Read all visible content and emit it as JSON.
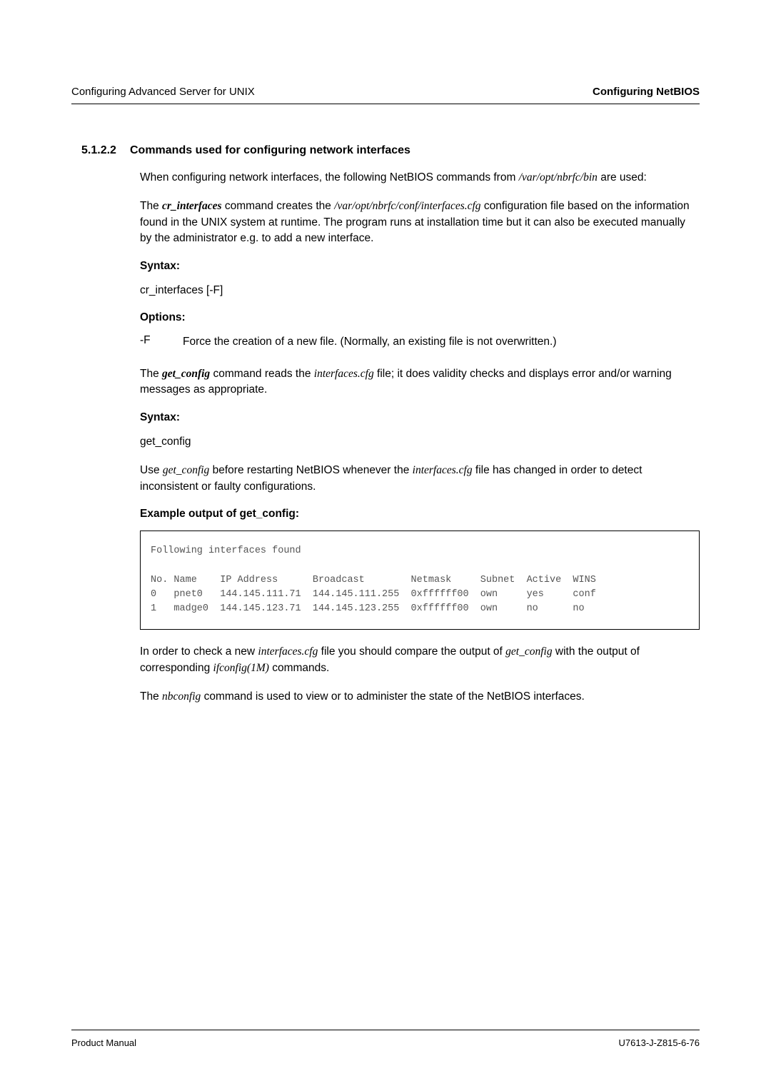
{
  "header": {
    "left": "Configuring Advanced Server for UNIX",
    "right": "Configuring NetBIOS"
  },
  "section": {
    "number": "5.1.2.2",
    "title": "Commands used for configuring network interfaces"
  },
  "p1_a": "When configuring network interfaces, the following NetBIOS commands from ",
  "p1_path": "/var/opt/nbrfc/bin",
  "p1_b": " are used:",
  "p2_a": "The ",
  "p2_cmd": "cr_interfaces",
  "p2_b": " command creates the ",
  "p2_path": "/var/opt/nbrfc/conf/interfaces.cfg",
  "p2_c": " configuration file based on the information found in the UNIX system at runtime. The program runs at installation time but it can also be executed manually by the administrator e.g. to add a new interface.",
  "syntax_label": "Syntax:",
  "syntax1": "cr_interfaces [-F]",
  "options_label": "Options:",
  "opt_flag": "-F",
  "opt_desc": "Force the creation of a new file. (Normally, an existing file is not overwritten.)",
  "p3_a": "The ",
  "p3_cmd": "get_config",
  "p3_b": " command reads the ",
  "p3_file": "interfaces.cfg",
  "p3_c": " file; it does validity checks and displays error and/or warning messages as appropriate.",
  "syntax2": "get_config",
  "p4_a": "Use ",
  "p4_cmd": "get_config",
  "p4_b": " before restarting NetBIOS whenever the ",
  "p4_file": "interfaces.cfg",
  "p4_c": " file has changed in order to detect inconsistent or faulty configurations.",
  "example_label": "Example output of get_config:",
  "code": "Following interfaces found\n\nNo. Name    IP Address      Broadcast        Netmask     Subnet  Active  WINS\n0   pnet0   144.145.111.71  144.145.111.255  0xffffff00  own     yes     conf\n1   madge0  144.145.123.71  144.145.123.255  0xffffff00  own     no      no",
  "chart_data": {
    "type": "table",
    "title": "Following interfaces found",
    "columns": [
      "No.",
      "Name",
      "IP Address",
      "Broadcast",
      "Netmask",
      "Subnet",
      "Active",
      "WINS"
    ],
    "rows": [
      [
        "0",
        "pnet0",
        "144.145.111.71",
        "144.145.111.255",
        "0xffffff00",
        "own",
        "yes",
        "conf"
      ],
      [
        "1",
        "madge0",
        "144.145.123.71",
        "144.145.123.255",
        "0xffffff00",
        "own",
        "no",
        "no"
      ]
    ]
  },
  "p5_a": "In order to check a new ",
  "p5_file": "interfaces.cfg",
  "p5_b": " file you should compare the output of ",
  "p5_cmd": "get_config",
  "p5_c": " with the output of corresponding ",
  "p5_cmd2": "ifconfig(1M)",
  "p5_d": " commands.",
  "p6_a": "The ",
  "p6_cmd": "nbconfig",
  "p6_b": " command is used to view or to administer the state of the NetBIOS interfaces.",
  "footer": {
    "left": "Product Manual",
    "right": "U7613-J-Z815-6-76"
  }
}
